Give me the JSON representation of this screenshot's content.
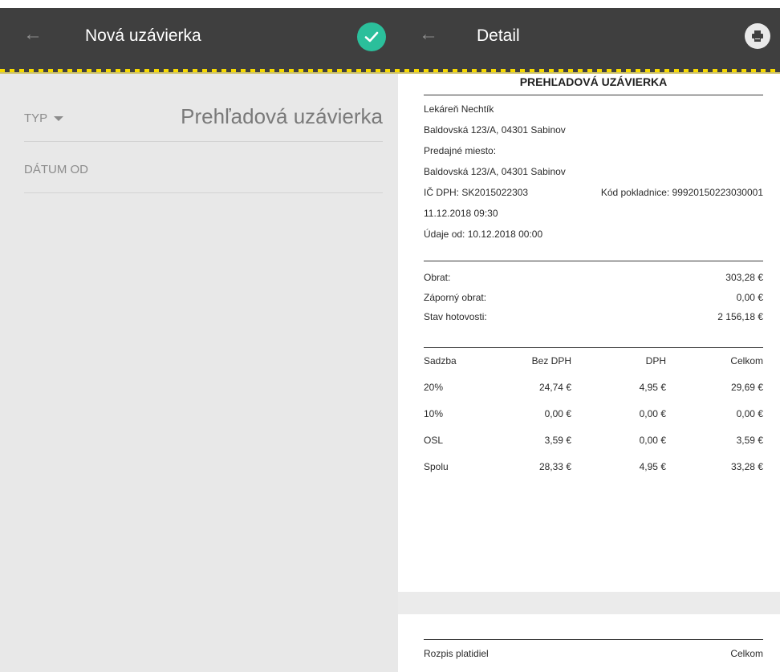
{
  "left_screen": {
    "title": "Nová uzávierka",
    "fields": {
      "typ_label": "TYP",
      "typ_value": "Prehľadová uzávierka",
      "datum_label": "DÁTUM OD"
    }
  },
  "right_screen": {
    "title": "Detail"
  },
  "document": {
    "heading": "PREHĽADOVÁ UZÁVIERKA",
    "info_lines": [
      "Lekáreň Nechtík",
      "Baldovská 123/A, 04301 Sabinov",
      "Predajné miesto:",
      "Baldovská 123/A, 04301 Sabinov"
    ],
    "ic_dph": "IČ DPH: SK2015022303",
    "kod_pokladnice": "Kód pokladnice: 99920150223030001",
    "datetime": "11.12.2018 09:30",
    "udaje_od": "Údaje od: 10.12.2018 00:00",
    "summary": [
      {
        "label": "Obrat:",
        "value": "303,28 €"
      },
      {
        "label": "Záporný obrat:",
        "value": "0,00 €"
      },
      {
        "label": "Stav hotovosti:",
        "value": "2 156,18 €"
      }
    ],
    "vat_table": {
      "headers": [
        "Sadzba",
        "Bez DPH",
        "DPH",
        "Celkom"
      ],
      "rows": [
        [
          "20%",
          "24,74 €",
          "4,95 €",
          "29,69 €"
        ],
        [
          "10%",
          "0,00 €",
          "0,00 €",
          "0,00 €"
        ],
        [
          "OSL",
          "3,59 €",
          "0,00 €",
          "3,59 €"
        ],
        [
          "Spolu",
          "28,33 €",
          "4,95 €",
          "33,28 €"
        ]
      ]
    },
    "payments": {
      "label": "Rozpis platidiel",
      "total_label": "Celkom"
    }
  },
  "colors": {
    "topbar": "#3f3f3f",
    "accent_check": "#2bbf9b",
    "stripe": "#f5d800"
  }
}
